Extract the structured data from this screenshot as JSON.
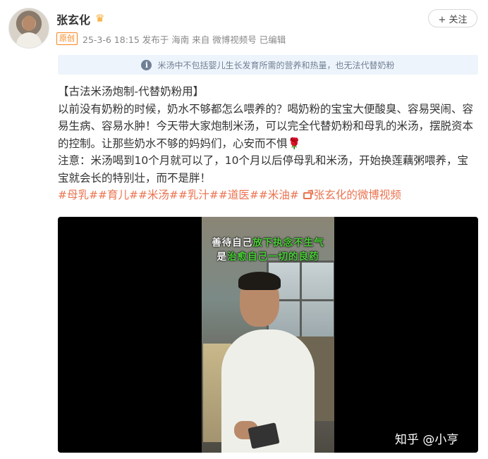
{
  "post": {
    "author": "张玄化",
    "original_badge": "原创",
    "meta": "25-3-6 18:15  发布于 海南  来自 微博视频号  已编辑",
    "follow_label": "+ 关注"
  },
  "notice": {
    "text": "米汤中不包括婴儿生长发育所需的营养和热量，也无法代替奶粉"
  },
  "content": {
    "title": "【古法米汤炮制-代替奶粉用】",
    "para1": "以前没有奶粉的时候，奶水不够都怎么喂养的？喝奶粉的宝宝大便酸臭、容易哭闹、容易生病、容易水肿！今天带大家炮制米汤，可以完全代替奶粉和母乳的米汤，摆脱资本的控制。让那些奶水不够的妈妈们，心安而不惧",
    "rose": "🌹",
    "para2": "注意：米汤喝到10个月就可以了，10个月以后停母乳和米汤，开始换莲藕粥喂养，宝宝就会长的特别壮，而不是胖！",
    "tags": "#母乳##育儿##米汤##乳汁##道医##米油#",
    "video_link": "张玄化的微博视频"
  },
  "video": {
    "caption_line1_white": "善待自己",
    "caption_line1_green": "放下执念不生气",
    "caption_line2_white": "是",
    "caption_line2_green": "治愈自己一切的良药",
    "watermark": "知乎 @小亨"
  },
  "colors": {
    "tag": "#eb7350",
    "notice_bg": "#eef4fb",
    "caption_green": "#4cd23a"
  }
}
